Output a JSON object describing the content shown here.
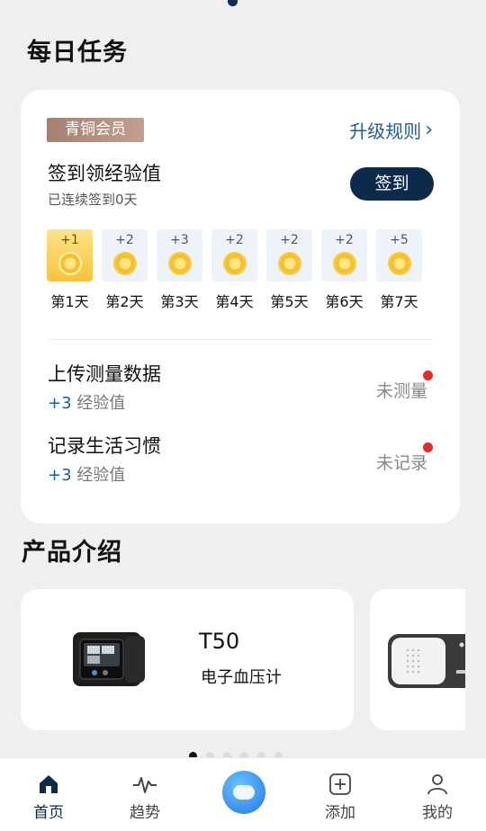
{
  "daily_tasks": {
    "title": "每日任务",
    "member_badge": "青铜会员",
    "upgrade_link": "升级规则",
    "checkin": {
      "title": "签到领经验值",
      "subtitle": "已连续签到0天",
      "button": "签到"
    },
    "days": [
      {
        "points": "+1",
        "label": "第1天",
        "active": true
      },
      {
        "points": "+2",
        "label": "第2天",
        "active": false
      },
      {
        "points": "+3",
        "label": "第3天",
        "active": false
      },
      {
        "points": "+2",
        "label": "第4天",
        "active": false
      },
      {
        "points": "+2",
        "label": "第5天",
        "active": false
      },
      {
        "points": "+2",
        "label": "第6天",
        "active": false
      },
      {
        "points": "+5",
        "label": "第7天",
        "active": false
      }
    ],
    "tasks": [
      {
        "title": "上传测量数据",
        "points": "+3",
        "exp_label": "经验值",
        "status": "未测量"
      },
      {
        "title": "记录生活习惯",
        "points": "+3",
        "exp_label": "经验值",
        "status": "未记录"
      }
    ]
  },
  "products": {
    "title": "产品介绍",
    "items": [
      {
        "name": "T50",
        "description": "电子血压计"
      }
    ]
  },
  "tabbar": {
    "home": "首页",
    "trend": "趋势",
    "add": "添加",
    "me": "我的"
  },
  "colors": {
    "accent": "#0d2a4d",
    "link": "#1d5d98",
    "badge": "#a48070",
    "alert": "#e02b2b"
  }
}
